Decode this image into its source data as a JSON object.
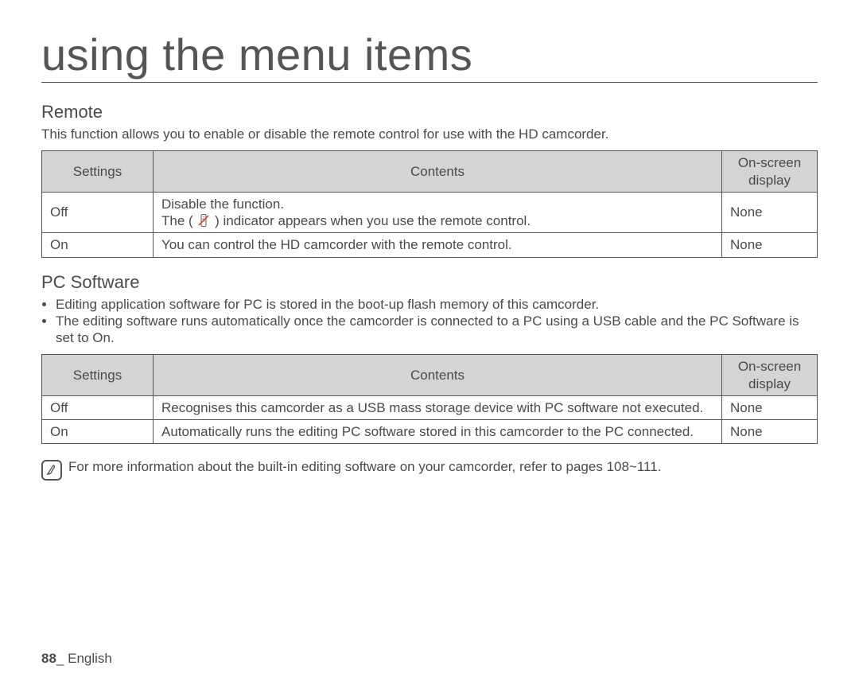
{
  "chapter_title": "using the menu items",
  "section_remote": {
    "title": "Remote",
    "desc": "This function allows you to enable or disable the remote control for use with the HD camcorder.",
    "headers": {
      "settings": "Settings",
      "contents": "Contents",
      "display": "On-screen display"
    },
    "rows": [
      {
        "setting": "Off",
        "content_line1": "Disable the function.",
        "content_line2a": "The (",
        "content_line2b": ") indicator appears when you use the remote control.",
        "display": "None"
      },
      {
        "setting": "On",
        "content": "You can control the HD camcorder with the remote control.",
        "display": "None"
      }
    ]
  },
  "section_pc": {
    "title": "PC Software",
    "bullets": [
      "Editing application software for PC is stored in the boot-up flash memory of this camcorder.",
      "The editing software runs automatically once the camcorder is connected to a PC using a USB cable and the PC Software is set to On."
    ],
    "headers": {
      "settings": "Settings",
      "contents": "Contents",
      "display": "On-screen display"
    },
    "rows": [
      {
        "setting": "Off",
        "content": "Recognises this camcorder as a USB mass storage device with PC software not executed.",
        "display": "None"
      },
      {
        "setting": "On",
        "content": "Automatically runs the editing PC software stored in this camcorder to the PC connected.",
        "display": "None"
      }
    ]
  },
  "note_text": "For more information about the built-in editing software on your camcorder, refer to pages 108~111.",
  "footer": {
    "page": "88",
    "sep": "_ ",
    "lang": "English"
  }
}
